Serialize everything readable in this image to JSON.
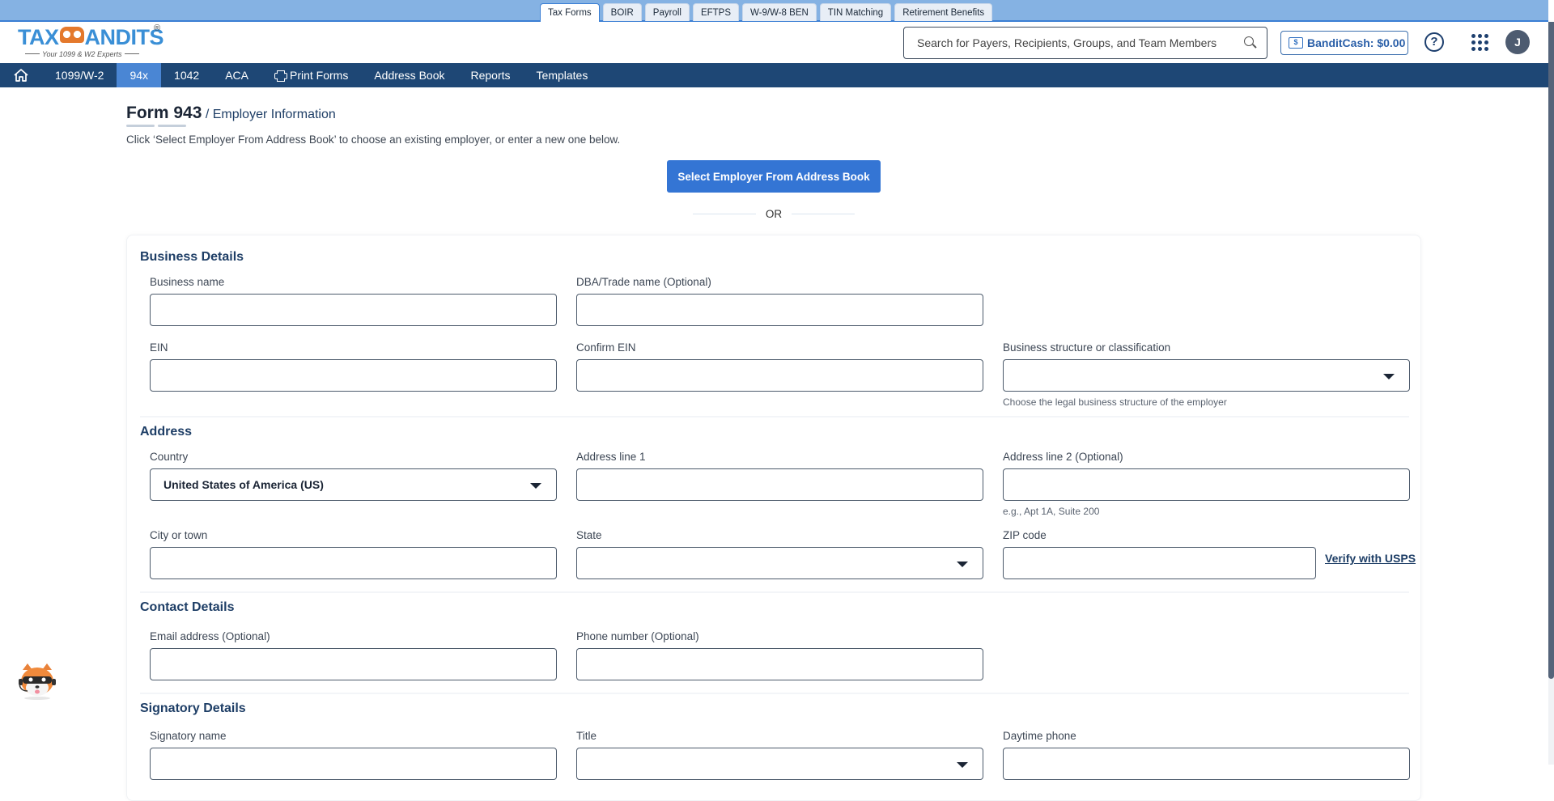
{
  "product_tabs": [
    {
      "label": "Tax Forms",
      "active": true
    },
    {
      "label": "BOIR",
      "active": false
    },
    {
      "label": "Payroll",
      "active": false
    },
    {
      "label": "EFTPS",
      "active": false
    },
    {
      "label": "W-9/W-8 BEN",
      "active": false
    },
    {
      "label": "TIN Matching",
      "active": false
    },
    {
      "label": "Retirement Benefits",
      "active": false
    }
  ],
  "header": {
    "logo_text_left": "TAX",
    "logo_text_right": "ANDITS",
    "logo_registered": "®",
    "logo_tagline": "Your 1099 & W2 Experts",
    "search_placeholder": "Search for Payers, Recipients, Groups, and Team Members",
    "search_value": "",
    "bandit_cash_label": "BanditCash: $0.00",
    "help_icon_glyph": "?",
    "avatar_initial": "J"
  },
  "icons": {
    "home": "home-icon",
    "print": "printer-icon",
    "search": "search-icon",
    "wallet": "wallet-icon",
    "help": "help-circle-icon",
    "apps": "apps-grid-icon",
    "caret": "caret-down-icon"
  },
  "main_nav": [
    {
      "label": "1099/W-2",
      "active": false
    },
    {
      "label": "94x",
      "active": true
    },
    {
      "label": "1042",
      "active": false
    },
    {
      "label": "ACA",
      "active": false
    },
    {
      "label": "Print Forms",
      "active": false,
      "icon": "printer-icon"
    },
    {
      "label": "Address Book",
      "active": false
    },
    {
      "label": "Reports",
      "active": false
    },
    {
      "label": "Templates",
      "active": false
    }
  ],
  "page": {
    "title": "Form 943",
    "subtitle": "/ Employer Information",
    "instruction": "Click ‘Select Employer From Address Book’ to choose an existing employer, or enter a new one below.",
    "select_button": "Select Employer From Address Book",
    "or_label": "OR"
  },
  "form": {
    "business": {
      "title": "Business Details",
      "business_name_label": "Business name",
      "business_name_value": "",
      "dba_label": "DBA/Trade name (Optional)",
      "dba_value": "",
      "ein_label": "EIN",
      "ein_value": "",
      "confirm_ein_label": "Confirm EIN",
      "confirm_ein_value": "",
      "structure_label": "Business structure or classification",
      "structure_value": "",
      "structure_hint": "Choose the legal business structure of the employer"
    },
    "address": {
      "title": "Address",
      "country_label": "Country",
      "country_value": "United States of America (US)",
      "line1_label": "Address line 1",
      "line1_value": "",
      "line2_label": "Address line 2 (Optional)",
      "line2_value": "",
      "line2_hint": "e.g., Apt 1A, Suite 200",
      "city_label": "City or town",
      "city_value": "",
      "state_label": "State",
      "state_value": "",
      "zip_label": "ZIP code",
      "zip_value": "",
      "verify_link": "Verify with USPS"
    },
    "contact": {
      "title": "Contact Details",
      "email_label": "Email address (Optional)",
      "email_value": "",
      "phone_label": "Phone number (Optional)",
      "phone_value": ""
    },
    "signatory": {
      "title": "Signatory Details",
      "name_label": "Signatory name",
      "name_value": "",
      "title_label": "Title",
      "title_value": "",
      "daytime_phone_label": "Daytime phone",
      "daytime_phone_value": ""
    }
  },
  "colors": {
    "nav_bg": "#1e4775",
    "nav_active": "#4a86d4",
    "primary_button": "#3475d4",
    "top_strip": "#85b2e3",
    "section_title": "#1e3e66"
  }
}
